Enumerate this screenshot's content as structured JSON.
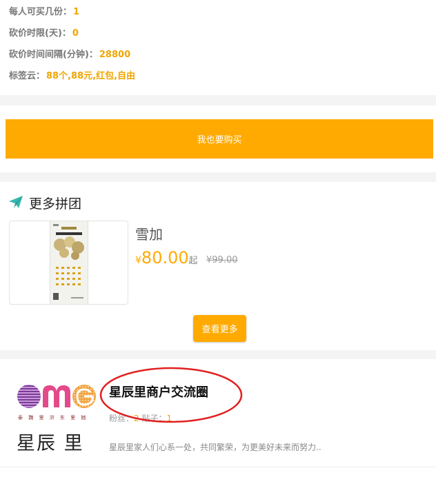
{
  "info": {
    "rows": [
      {
        "label": "每人可买几份：",
        "value": "1"
      },
      {
        "label": "砍价时限(天)：",
        "value": "0"
      },
      {
        "label": "砍价时间间隔(分钟)：",
        "value": "28800"
      },
      {
        "label": "标签云：",
        "value": "88个,88元,红包,自由"
      }
    ]
  },
  "buy": {
    "label": "我也要购买"
  },
  "more_groups": {
    "title": "更多拼团",
    "icon": "paper-plane-icon",
    "product": {
      "name": "雪加",
      "currency": "¥",
      "price": "80.00",
      "suffix": "起",
      "original_price": "¥99.00"
    },
    "see_more_label": "查看更多"
  },
  "circle": {
    "logo_slogan": "泰 魏 里 浒 东 里 她",
    "logo_text": "星辰 里",
    "name": "星辰里商户交流圈",
    "fans_label": "粉丝：",
    "fans": "2",
    "posts_label": " 贴子：",
    "posts": "1",
    "description": "星辰里家人们心系一处，共同繁荣，为更美好未来而努力.."
  },
  "colors": {
    "accent": "#ffaa00",
    "teal": "#36b8b0",
    "annotation": "#e02020"
  }
}
